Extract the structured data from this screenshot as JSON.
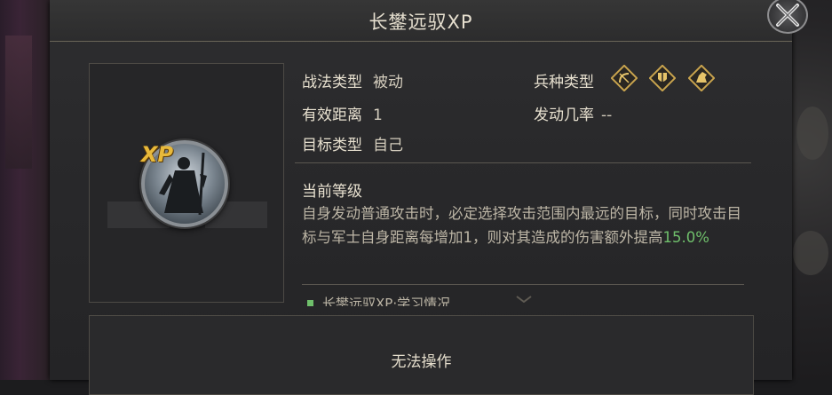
{
  "window": {
    "title": "长鐢远驭XP"
  },
  "skill": {
    "tag": "XP",
    "tactic_type_label": "战法类型",
    "tactic_type_value": "被动",
    "range_label": "有效距离",
    "range_value": "1",
    "target_label": "目标类型",
    "target_value": "自己",
    "troop_type_label": "兵种类型",
    "trigger_rate_label": "发动几率",
    "trigger_rate_value": "--",
    "troop_icons": [
      "bow-troop-icon",
      "shield-troop-icon",
      "cavalry-troop-icon"
    ]
  },
  "level": {
    "heading": "当前等级",
    "desc_main": "自身发动普通攻击时，必定选择攻击范围内最远的目标，同时攻击目标与军士自身距离每增加1，则对其造成的伤害额外提高",
    "desc_value": "15.0%"
  },
  "learn": {
    "label": "长鐢远驭XP·学习情况"
  },
  "action": {
    "label": "无法操作"
  },
  "colors": {
    "accent_gold": "#e8b93a",
    "highlight_green": "#6fbf6b"
  }
}
